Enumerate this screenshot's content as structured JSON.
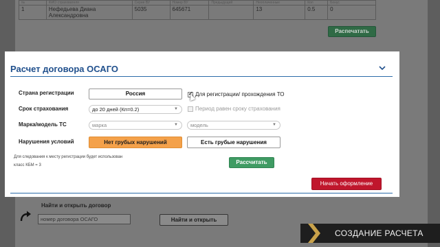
{
  "background_table": {
    "header_cells": [
      "№",
      "ФИО страхователя",
      "Серия ВУ",
      "Номер ВУ",
      "Предыдущий",
      "Неоплаченные",
      "Кол",
      "Бонус"
    ],
    "row": [
      "1",
      "Нефедьева Диана Александровна",
      "5035",
      "645671",
      "",
      "13",
      "0.5",
      "0"
    ]
  },
  "background_print_button": "Распечатать",
  "dialog": {
    "title": "Расчет договора ОСАГО",
    "collapse_icon": "chevron-down-icon",
    "registration_country": {
      "label": "Страна регистрации",
      "value": "Россия",
      "checkbox_label": "Для регистрации/ прохождения ТО",
      "checkbox_checked": true
    },
    "insurance_term": {
      "label": "Срок страхования",
      "value": "до 20 дней (Кп=0.2)",
      "checkbox_label": "Период равен сроку страхования",
      "checkbox_disabled": true
    },
    "vehicle": {
      "label": "Марка/модель ТС",
      "make_placeholder": "марка",
      "model_placeholder": "модель"
    },
    "violations": {
      "label": "Нарушения условий",
      "option_none": "Нет грубых нарушений",
      "option_some": "Есть грубые нарушения",
      "selected": "Нет грубых нарушений"
    },
    "note_line1": "Для следования к месту регистрации будет использован",
    "note_line2": "класс КБМ = 3",
    "calculate_button": "Рассчитать",
    "start_button": "Начать оформление"
  },
  "find_section": {
    "title": "Найти и открыть договор",
    "input_placeholder": "номер договора ОСАГО",
    "button": "Найти и открыть"
  },
  "caption": "СОЗДАНИЕ РАСЧЕТА",
  "colors": {
    "title_blue": "#1f4f8c",
    "orange": "#f4a14a",
    "green": "#3f9b63",
    "red": "#c0162c"
  }
}
